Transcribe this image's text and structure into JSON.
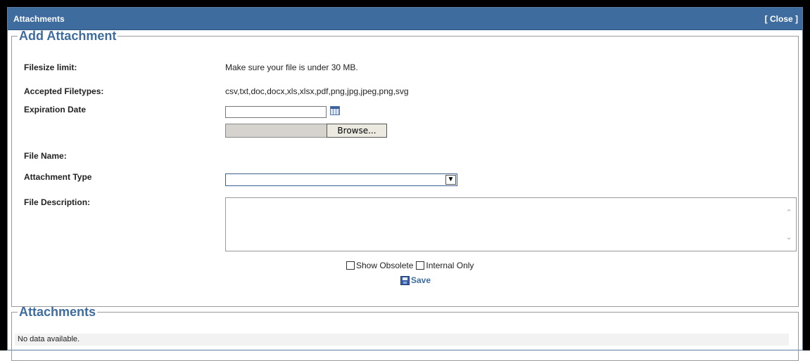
{
  "dialog": {
    "title": "Attachments",
    "close_label": "[ Close ]"
  },
  "add_attachment": {
    "legend": "Add Attachment",
    "filesize_label": "Filesize limit:",
    "filesize_value": "Make sure your file is under 30 MB.",
    "filetypes_label": "Accepted Filetypes:",
    "filetypes_value": "csv,txt,doc,docx,xls,xlsx,pdf,png,jpg,jpeg,png,svg",
    "expiration_label": "Expiration Date",
    "expiration_value": "",
    "browse_label": "Browse...",
    "file_name_label": "File Name:",
    "attachment_type_label": "Attachment Type",
    "attachment_type_value": "",
    "description_label": "File Description:",
    "description_value": "",
    "show_obsolete_label": "Show Obsolete",
    "internal_only_label": "Internal Only",
    "save_label": "Save"
  },
  "attachments_list": {
    "legend": "Attachments",
    "empty_text": "No data available."
  },
  "colors": {
    "titlebar": "#3e6c9f",
    "legend": "#3e6c9f"
  }
}
